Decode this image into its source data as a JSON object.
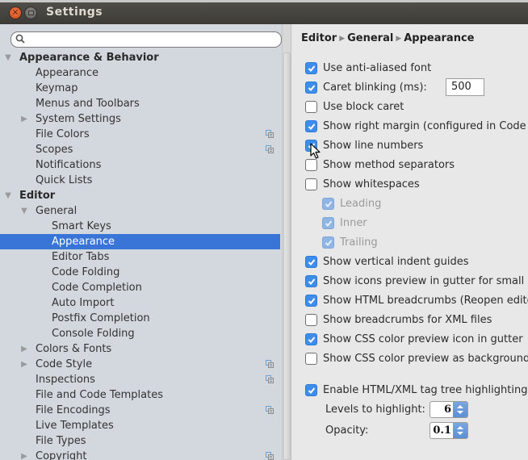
{
  "window": {
    "title": "Settings"
  },
  "search": {
    "placeholder": "",
    "value": ""
  },
  "sidebar": {
    "items": [
      {
        "label": "Appearance & Behavior",
        "level": 0,
        "expanded": true,
        "bold": true
      },
      {
        "label": "Appearance",
        "level": 1
      },
      {
        "label": "Keymap",
        "level": 1
      },
      {
        "label": "Menus and Toolbars",
        "level": 1
      },
      {
        "label": "System Settings",
        "level": 1,
        "collapsed": true
      },
      {
        "label": "File Colors",
        "level": 1,
        "project_icon": true
      },
      {
        "label": "Scopes",
        "level": 1,
        "project_icon": true
      },
      {
        "label": "Notifications",
        "level": 1
      },
      {
        "label": "Quick Lists",
        "level": 1
      },
      {
        "label": "Editor",
        "level": 0,
        "expanded": true,
        "bold": true
      },
      {
        "label": "General",
        "level": 1,
        "expanded": true
      },
      {
        "label": "Smart Keys",
        "level": 2
      },
      {
        "label": "Appearance",
        "level": 2,
        "selected": true
      },
      {
        "label": "Editor Tabs",
        "level": 2
      },
      {
        "label": "Code Folding",
        "level": 2
      },
      {
        "label": "Code Completion",
        "level": 2
      },
      {
        "label": "Auto Import",
        "level": 2
      },
      {
        "label": "Postfix Completion",
        "level": 2
      },
      {
        "label": "Console Folding",
        "level": 2
      },
      {
        "label": "Colors & Fonts",
        "level": 1,
        "collapsed": true
      },
      {
        "label": "Code Style",
        "level": 1,
        "collapsed": true,
        "project_icon": true
      },
      {
        "label": "Inspections",
        "level": 1,
        "project_icon": true
      },
      {
        "label": "File and Code Templates",
        "level": 1
      },
      {
        "label": "File Encodings",
        "level": 1,
        "project_icon": true
      },
      {
        "label": "Live Templates",
        "level": 1
      },
      {
        "label": "File Types",
        "level": 1
      },
      {
        "label": "Copyright",
        "level": 1,
        "collapsed": true,
        "project_icon": true
      }
    ]
  },
  "breadcrumb": [
    "Editor",
    "General",
    "Appearance"
  ],
  "options": [
    {
      "label": "Use anti-aliased font",
      "checked": true
    },
    {
      "label": "Caret blinking (ms):",
      "checked": true,
      "input_value": "500"
    },
    {
      "label": "Use block caret",
      "checked": false
    },
    {
      "label": "Show right margin (configured in Code Style options)",
      "checked": true
    },
    {
      "label": "Show line numbers",
      "checked": true
    },
    {
      "label": "Show method separators",
      "checked": false
    },
    {
      "label": "Show whitespaces",
      "checked": false
    },
    {
      "label": "Leading",
      "checked": true,
      "disabled": true,
      "indent": true
    },
    {
      "label": "Inner",
      "checked": true,
      "disabled": true,
      "indent": true
    },
    {
      "label": "Trailing",
      "checked": true,
      "disabled": true,
      "indent": true
    },
    {
      "label": "Show vertical indent guides",
      "checked": true
    },
    {
      "label": "Show icons preview in gutter for small icons",
      "checked": true
    },
    {
      "label": "Show HTML breadcrumbs (Reopen editor)",
      "checked": true
    },
    {
      "label": "Show breadcrumbs for XML files",
      "checked": false
    },
    {
      "label": "Show CSS color preview icon in gutter",
      "checked": true
    },
    {
      "label": "Show CSS color preview as background",
      "checked": false
    },
    {
      "label": "Enable HTML/XML tag tree highlighting",
      "checked": true
    }
  ],
  "tag_highlight": {
    "levels_label": "Levels to highlight:",
    "levels_value": "6",
    "opacity_label": "Opacity:",
    "opacity_value": "0.1"
  },
  "colors": {
    "accent": "#3875d7",
    "checkbox": "#3d8ee8",
    "sidebar_bg": "#d3d7de",
    "content_bg": "#e8e8e8"
  }
}
